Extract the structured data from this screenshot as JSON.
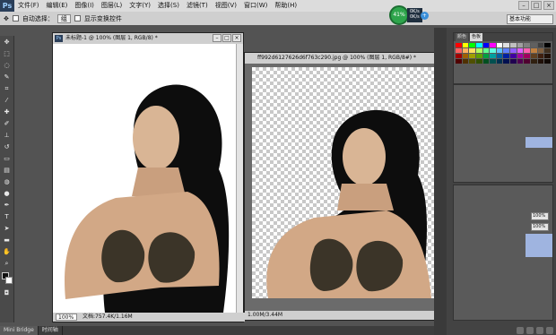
{
  "app": {
    "logo": "Ps"
  },
  "menus": [
    "文件(F)",
    "编辑(E)",
    "图像(I)",
    "图层(L)",
    "文字(Y)",
    "选择(S)",
    "滤镜(T)",
    "视图(V)",
    "窗口(W)",
    "帮助(H)"
  ],
  "options": {
    "auto_select": "自动选择：",
    "auto_select_value": "组",
    "show_transform": "显示变换控件"
  },
  "perf": {
    "percent": "41%",
    "stat1": "0K/s",
    "stat2": "0K/s"
  },
  "workspace": "基本功能",
  "doc1": {
    "title": "未标题-1 @ 100% (图层 1, RGB/8) *",
    "zoom": "100%",
    "info": "文档:757.4K/1.16M"
  },
  "doc2": {
    "title": "ff992d6127626d6f763c290.jpg @ 100% (图层 1, RGB/8#) *",
    "info": "1.00M/3.44M"
  },
  "panels": {
    "tab_swatch": "颜色",
    "tab_color": "色板",
    "pct1": "100%",
    "pct2": "100%"
  },
  "bottom": {
    "tab1": "Mini Bridge",
    "tab2": "时间轴"
  },
  "colors": {
    "accent": "#2ea54c",
    "dark": "#535353"
  }
}
